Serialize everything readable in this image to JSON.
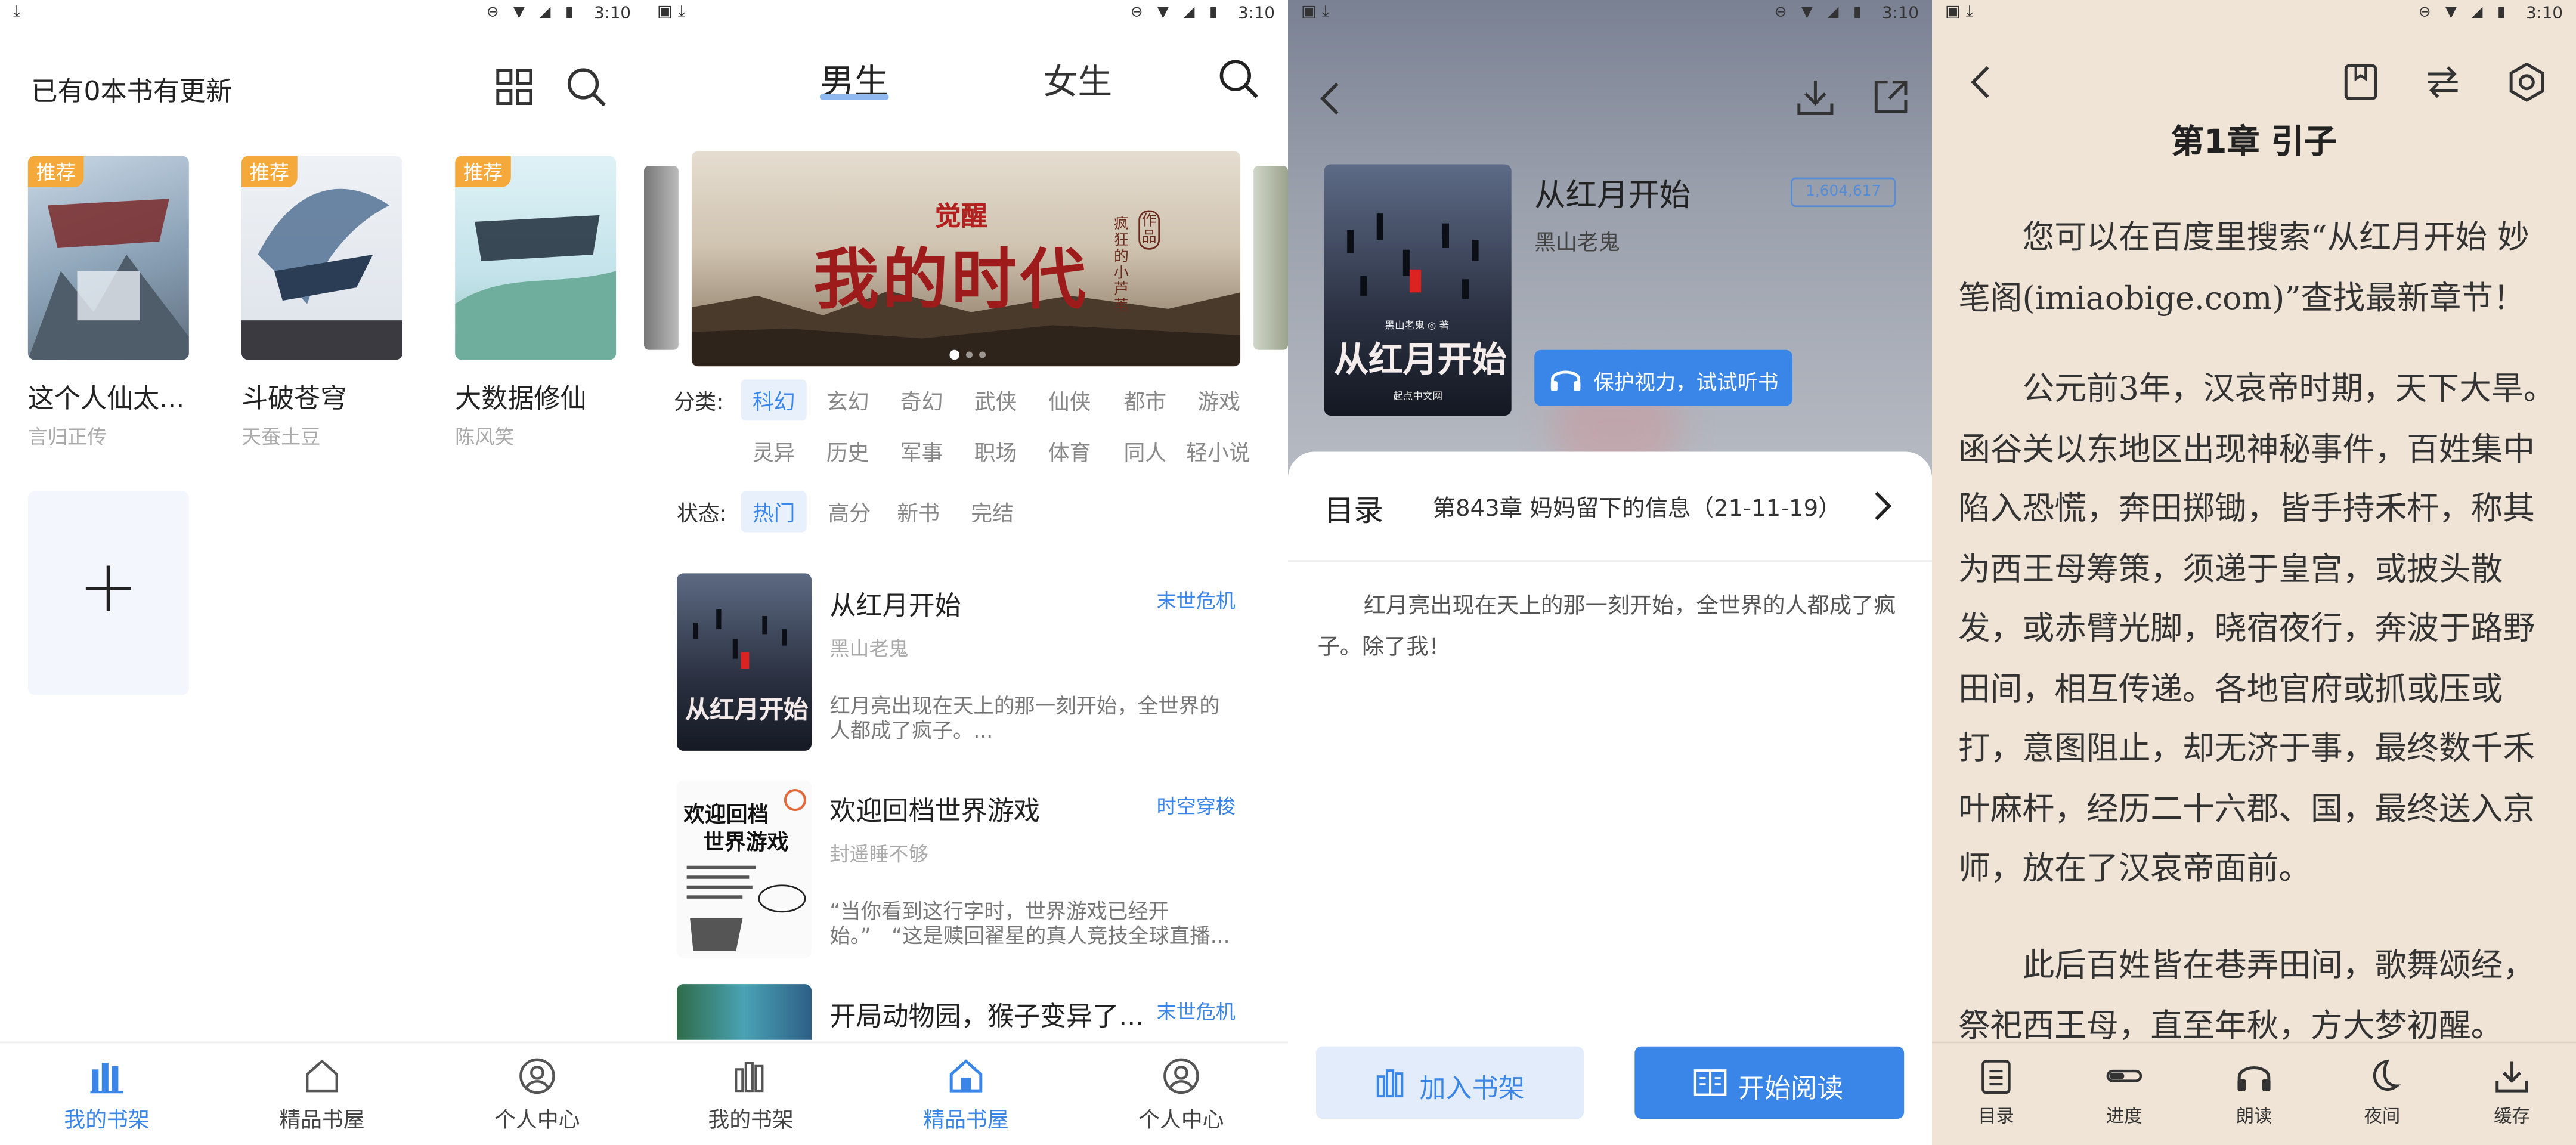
{
  "status": {
    "time": "3:10"
  },
  "shelf": {
    "header": "已有0本书有更新",
    "tag": "推荐",
    "books": [
      {
        "title": "这个人仙太...",
        "author": "言归正传"
      },
      {
        "title": "斗破苍穹",
        "author": "天蚕土豆"
      },
      {
        "title": "大数据修仙",
        "author": "陈风笑"
      }
    ],
    "add_symbol": "+"
  },
  "nav": {
    "shelf": "我的书架",
    "store": "精品书屋",
    "profile": "个人中心"
  },
  "store": {
    "tabs": {
      "male": "男生",
      "female": "女生"
    },
    "banner": {
      "top": "觉醒",
      "main": "我的时代",
      "side": "疯狂的小芦苇",
      "tag": "作品"
    },
    "category_label": "分类:",
    "categories": [
      "科幻",
      "玄幻",
      "奇幻",
      "武侠",
      "仙侠",
      "都市",
      "游戏",
      "灵异",
      "历史",
      "军事",
      "职场",
      "体育",
      "同人",
      "轻小说"
    ],
    "status_label": "状态:",
    "statuses": [
      "热门",
      "高分",
      "新书",
      "完结"
    ],
    "items": [
      {
        "title": "从红月开始",
        "author": "黑山老鬼",
        "genre": "末世危机",
        "desc": "红月亮出现在天上的那一刻开始，全世界的人都成了疯子。..."
      },
      {
        "title": "欢迎回档世界游戏",
        "author": "封遥睡不够",
        "genre": "时空穿梭",
        "desc": "“当你看到这行字时，世界游戏已经开始。”　“这是赎回翟星的真人竞技全球直播..."
      },
      {
        "title": "开局动物园，猴子变异了...",
        "author": "",
        "genre": "末世危机",
        "desc": ""
      }
    ]
  },
  "detail": {
    "title": "从红月开始",
    "author": "黑山老鬼",
    "badge": "1,604,617",
    "cover_text": "从红月开始",
    "cover_author": "黑山老鬼 ◎ 著",
    "cover_publisher": "起点中文网",
    "listen_button": "保护视力，试试听书",
    "toc_label": "目录",
    "latest_chapter": "第843章 妈妈留下的信息（21-11-19）",
    "intro": "红月亮出现在天上的那一刻开始，全世界的人都成了疯子。除了我！",
    "add_shelf": "加入书架",
    "start_read": "开始阅读"
  },
  "reader": {
    "chapter_title": "第1章 引子",
    "paragraphs": [
      "您可以在百度里搜索“从红月开始 妙笔阁(imiaobige.com)”查找最新章节！",
      "公元前3年，汉哀帝时期，天下大旱。函谷关以东地区出现神秘事件，百姓集中陷入恐慌，奔田掷锄，皆手持禾杆，称其为西王母筹策，须递于皇宫，或披头散发，或赤臂光脚，晓宿夜行，奔波于路野田间，相互传递。各地官府或抓或压或打，意图阻止，却无济于事，最终数千禾叶麻杆，经历二十六郡、国，最终送入京师，放在了汉哀帝面前。",
      "此后百姓皆在巷弄田间，歌舞颂经，祭祀西王母，直至年秋，方大梦初醒。"
    ],
    "toolbar": {
      "toc": "目录",
      "progress": "进度",
      "listen": "朗读",
      "night": "夜间",
      "cache": "缓存"
    }
  }
}
